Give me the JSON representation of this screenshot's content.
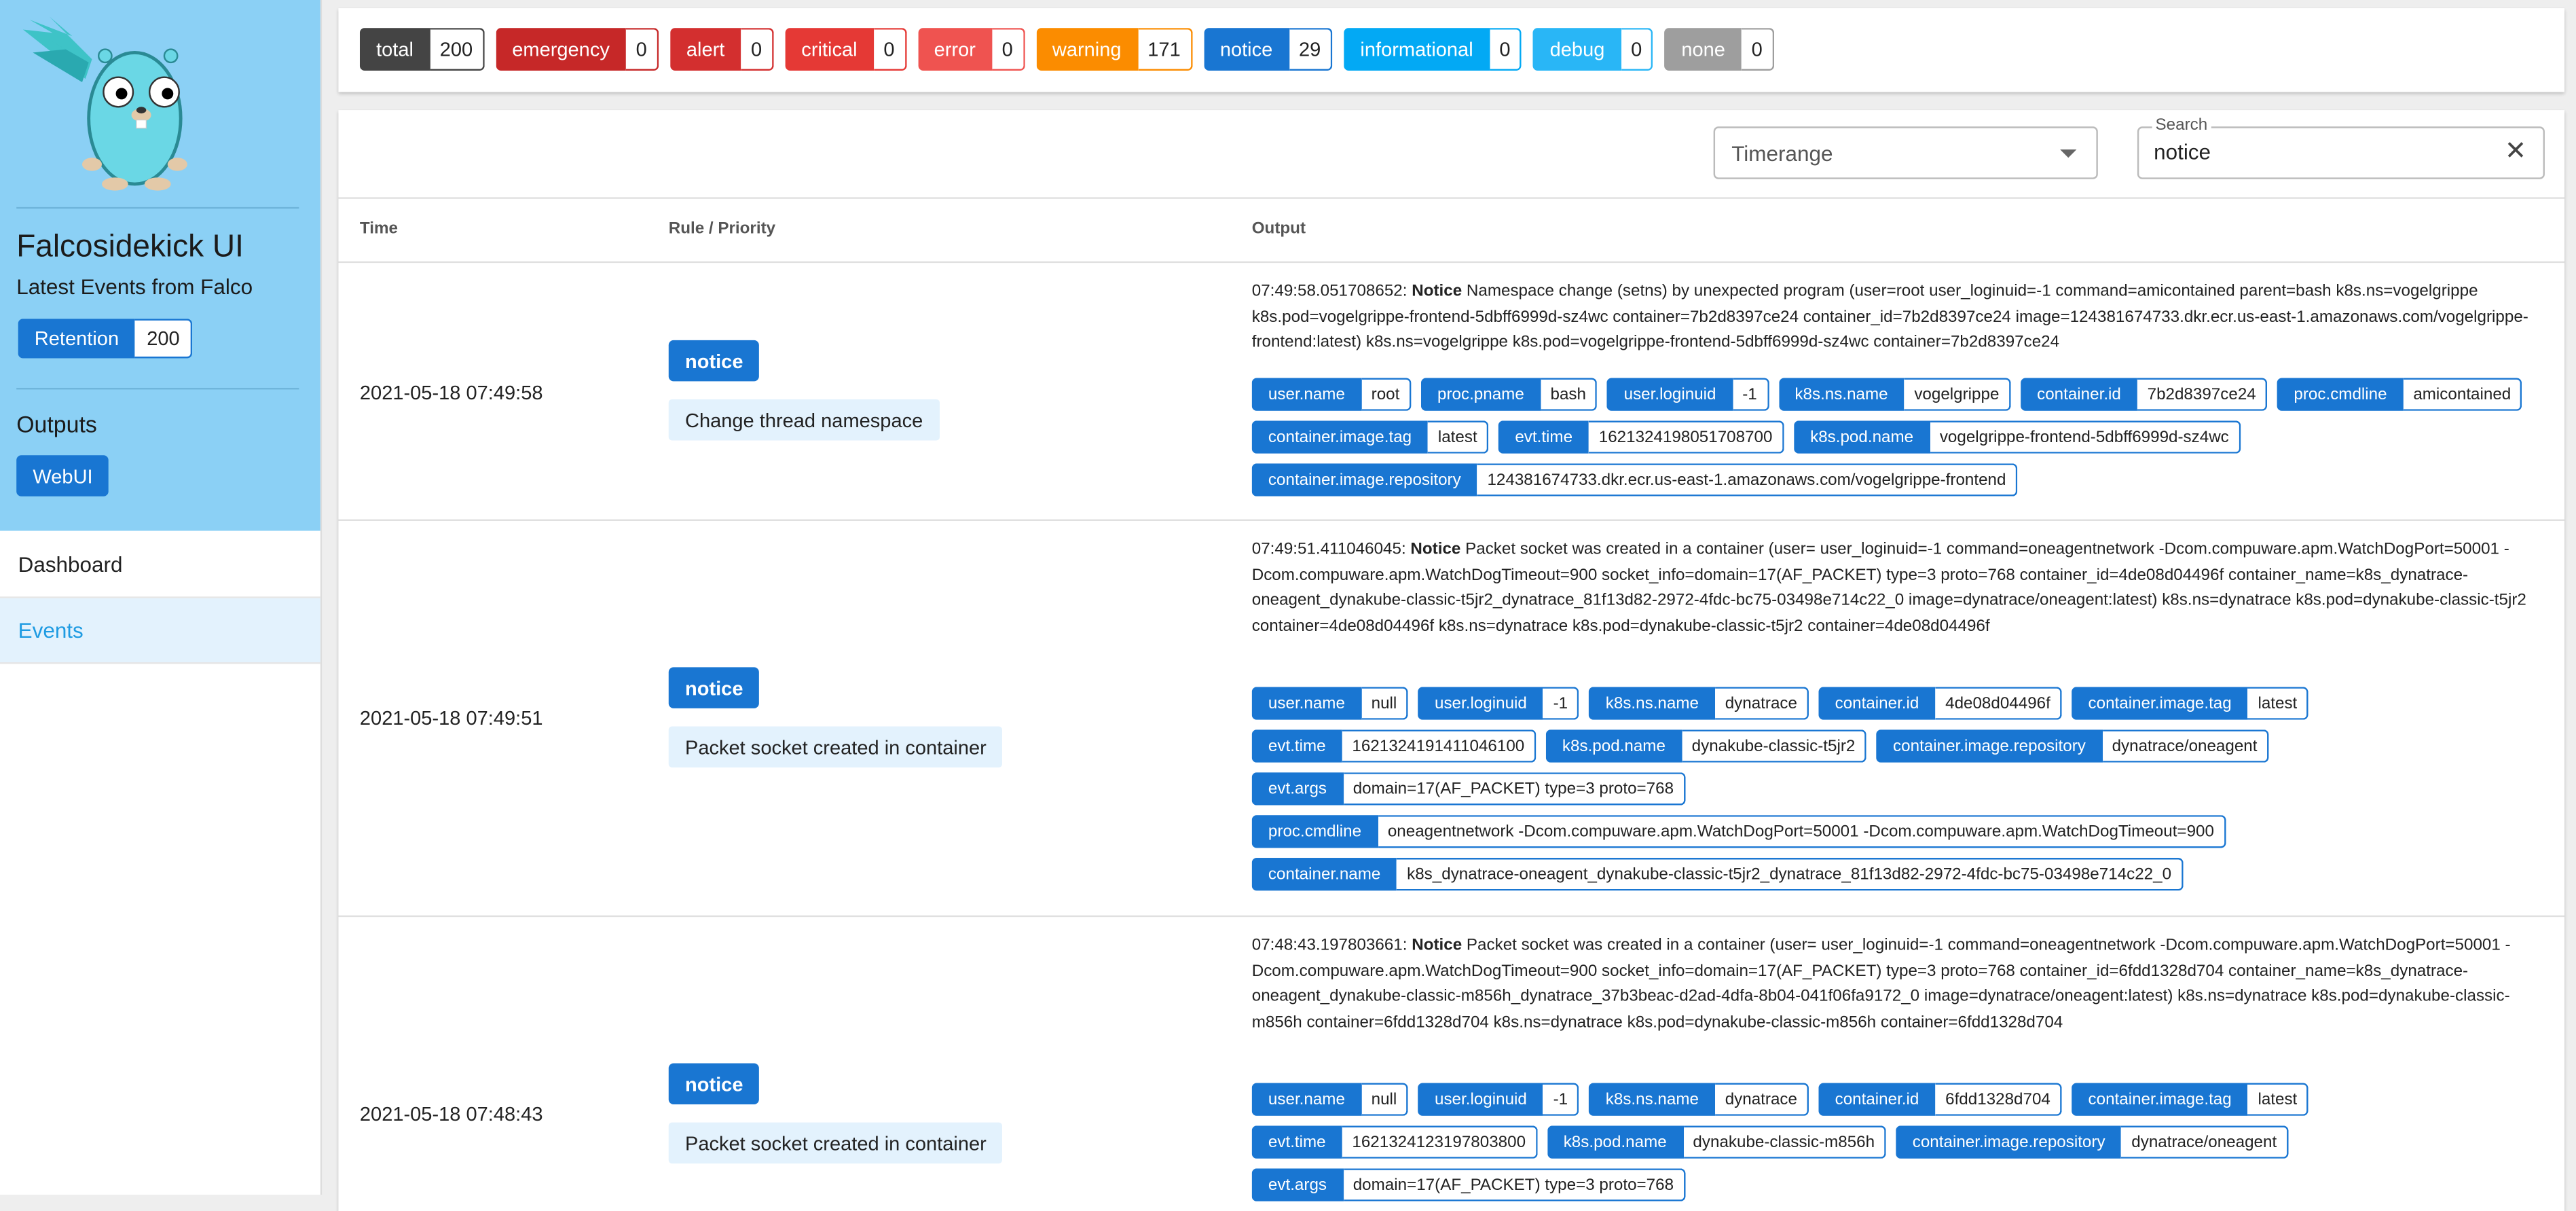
{
  "sidebar": {
    "title": "Falcosidekick UI",
    "subtitle": "Latest Events from Falco",
    "retention": {
      "label": "Retention",
      "value": "200"
    },
    "outputs_label": "Outputs",
    "webui_label": "WebUI",
    "nav": [
      {
        "label": "Dashboard"
      },
      {
        "label": "Events"
      }
    ]
  },
  "counters": [
    {
      "label": "total",
      "value": "200",
      "color": "#444444"
    },
    {
      "label": "emergency",
      "value": "0",
      "color": "#c62828"
    },
    {
      "label": "alert",
      "value": "0",
      "color": "#d32f2f"
    },
    {
      "label": "critical",
      "value": "0",
      "color": "#e53935"
    },
    {
      "label": "error",
      "value": "0",
      "color": "#ef5350"
    },
    {
      "label": "warning",
      "value": "171",
      "color": "#fb8c00"
    },
    {
      "label": "notice",
      "value": "29",
      "color": "#1976d2"
    },
    {
      "label": "informational",
      "value": "0",
      "color": "#03a9f4"
    },
    {
      "label": "debug",
      "value": "0",
      "color": "#29b6f6"
    },
    {
      "label": "none",
      "value": "0",
      "color": "#9e9e9e"
    }
  ],
  "filters": {
    "timerange_placeholder": "Timerange",
    "search_label": "Search",
    "search_value": "notice"
  },
  "table": {
    "headers": {
      "time": "Time",
      "rule": "Rule / Priority",
      "output": "Output"
    },
    "rows": [
      {
        "time": "2021-05-18 07:49:58",
        "priority": "notice",
        "rule": "Change thread namespace",
        "output_ts": "07:49:58.051708652:",
        "output_level": "Notice",
        "output_text": "Namespace change (setns) by unexpected program (user=root user_loginuid=-1 command=amicontained parent=bash k8s.ns=vogelgrippe k8s.pod=vogelgrippe-frontend-5dbff6999d-sz4wc container=7b2d8397ce24 container_id=7b2d8397ce24 image=124381674733.dkr.ecr.us-east-1.amazonaws.com/vogelgrippe-frontend:latest) k8s.ns=vogelgrippe k8s.pod=vogelgrippe-frontend-5dbff6999d-sz4wc container=7b2d8397ce24",
        "tags": [
          {
            "k": "user.name",
            "v": "root"
          },
          {
            "k": "proc.pname",
            "v": "bash"
          },
          {
            "k": "user.loginuid",
            "v": "-1"
          },
          {
            "k": "k8s.ns.name",
            "v": "vogelgrippe"
          },
          {
            "k": "container.id",
            "v": "7b2d8397ce24"
          },
          {
            "k": "proc.cmdline",
            "v": "amicontained"
          },
          {
            "k": "container.image.tag",
            "v": "latest"
          },
          {
            "k": "evt.time",
            "v": "1621324198051708700"
          },
          {
            "k": "k8s.pod.name",
            "v": "vogelgrippe-frontend-5dbff6999d-sz4wc"
          },
          {
            "k": "container.image.repository",
            "v": "124381674733.dkr.ecr.us-east-1.amazonaws.com/vogelgrippe-frontend"
          }
        ]
      },
      {
        "time": "2021-05-18 07:49:51",
        "priority": "notice",
        "rule": "Packet socket created in container",
        "output_ts": "07:49:51.411046045:",
        "output_level": "Notice",
        "output_text": "Packet socket was created in a container (user= user_loginuid=-1 command=oneagentnetwork -Dcom.compuware.apm.WatchDogPort=50001 -Dcom.compuware.apm.WatchDogTimeout=900 socket_info=domain=17(AF_PACKET) type=3 proto=768 container_id=4de08d04496f container_name=k8s_dynatrace-oneagent_dynakube-classic-t5jr2_dynatrace_81f13d82-2972-4fdc-bc75-03498e714c22_0 image=dynatrace/oneagent:latest) k8s.ns=dynatrace k8s.pod=dynakube-classic-t5jr2 container=4de08d04496f k8s.ns=dynatrace k8s.pod=dynakube-classic-t5jr2 container=4de08d04496f",
        "tags": [
          {
            "k": "user.name",
            "v": "null"
          },
          {
            "k": "user.loginuid",
            "v": "-1"
          },
          {
            "k": "k8s.ns.name",
            "v": "dynatrace"
          },
          {
            "k": "container.id",
            "v": "4de08d04496f"
          },
          {
            "k": "container.image.tag",
            "v": "latest"
          },
          {
            "k": "evt.time",
            "v": "1621324191411046100"
          },
          {
            "k": "k8s.pod.name",
            "v": "dynakube-classic-t5jr2"
          },
          {
            "k": "container.image.repository",
            "v": "dynatrace/oneagent"
          },
          {
            "k": "evt.args",
            "v": "domain=17(AF_PACKET) type=3 proto=768"
          },
          {
            "k": "proc.cmdline",
            "v": "oneagentnetwork -Dcom.compuware.apm.WatchDogPort=50001 -Dcom.compuware.apm.WatchDogTimeout=900"
          },
          {
            "k": "container.name",
            "v": "k8s_dynatrace-oneagent_dynakube-classic-t5jr2_dynatrace_81f13d82-2972-4fdc-bc75-03498e714c22_0"
          }
        ]
      },
      {
        "time": "2021-05-18 07:48:43",
        "priority": "notice",
        "rule": "Packet socket created in container",
        "output_ts": "07:48:43.197803661:",
        "output_level": "Notice",
        "output_text": "Packet socket was created in a container (user= user_loginuid=-1 command=oneagentnetwork -Dcom.compuware.apm.WatchDogPort=50001 -Dcom.compuware.apm.WatchDogTimeout=900 socket_info=domain=17(AF_PACKET) type=3 proto=768 container_id=6fdd1328d704 container_name=k8s_dynatrace-oneagent_dynakube-classic-m856h_dynatrace_37b3beac-d2ad-4dfa-8b04-041f06fa9172_0 image=dynatrace/oneagent:latest) k8s.ns=dynatrace k8s.pod=dynakube-classic-m856h container=6fdd1328d704 k8s.ns=dynatrace k8s.pod=dynakube-classic-m856h container=6fdd1328d704",
        "tags": [
          {
            "k": "user.name",
            "v": "null"
          },
          {
            "k": "user.loginuid",
            "v": "-1"
          },
          {
            "k": "k8s.ns.name",
            "v": "dynatrace"
          },
          {
            "k": "container.id",
            "v": "6fdd1328d704"
          },
          {
            "k": "container.image.tag",
            "v": "latest"
          },
          {
            "k": "evt.time",
            "v": "1621324123197803800"
          },
          {
            "k": "k8s.pod.name",
            "v": "dynakube-classic-m856h"
          },
          {
            "k": "container.image.repository",
            "v": "dynatrace/oneagent"
          },
          {
            "k": "evt.args",
            "v": "domain=17(AF_PACKET) type=3 proto=768"
          }
        ]
      }
    ]
  }
}
